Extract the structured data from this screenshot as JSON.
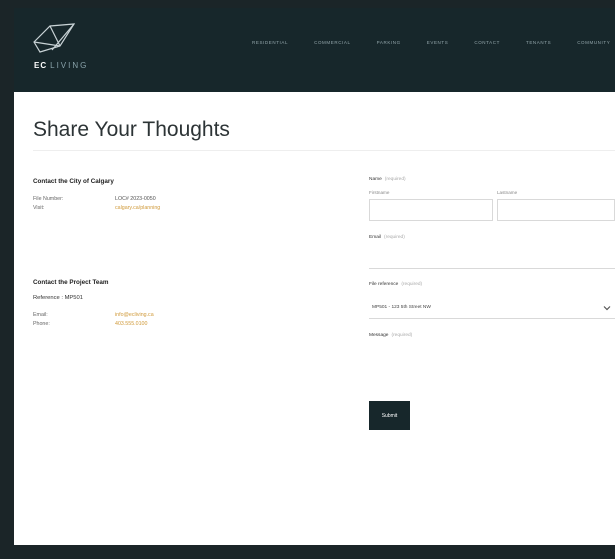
{
  "brand": {
    "mark": "EC",
    "word": "LIVING"
  },
  "nav": {
    "items": [
      {
        "label": "Residential"
      },
      {
        "label": "Commercial"
      },
      {
        "label": "Parking"
      },
      {
        "label": "Events"
      },
      {
        "label": "Contact"
      },
      {
        "label": "Tenants"
      },
      {
        "label": "Community"
      }
    ]
  },
  "page": {
    "title": "Share Your Thoughts"
  },
  "city_contact": {
    "heading": "Contact the City of Calgary",
    "file_number_label": "File Number:",
    "file_number_value": "LOC# 2023-0050",
    "visit_label": "Visit:",
    "visit_value": "calgary.ca/planning"
  },
  "project_contact": {
    "heading": "Contact the Project Team",
    "reference": "Reference : MP501",
    "email_label": "Email:",
    "email_value": "info@ecliving.ca",
    "phone_label": "Phone:",
    "phone_value": "403.555.0100"
  },
  "form": {
    "name_label": "Name",
    "name_required": "(required)",
    "firstname_label": "Firstname",
    "lastname_label": "Lastname",
    "email_label": "Email",
    "email_required": "(required)",
    "reference_label": "File reference",
    "reference_required": "(required)",
    "reference_selected": "MP501 - 123 5th Street NW",
    "message_label": "Message",
    "message_required": "(required)",
    "submit_label": "Submit"
  }
}
